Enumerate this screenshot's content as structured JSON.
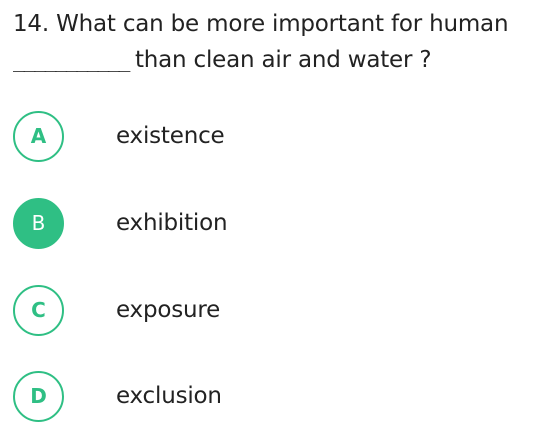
{
  "question": {
    "line1": "14. What can be more important for human",
    "blank": "___________",
    "line2_rest": "than clean air and water ?"
  },
  "options": [
    {
      "letter": "A",
      "text": "existence",
      "selected": false
    },
    {
      "letter": "B",
      "text": "exhibition",
      "selected": true
    },
    {
      "letter": "C",
      "text": "exposure",
      "selected": false
    },
    {
      "letter": "D",
      "text": "exclusion",
      "selected": false
    }
  ],
  "colors": {
    "accent": "#2fbf84",
    "text": "#222222",
    "background": "#ffffff"
  }
}
